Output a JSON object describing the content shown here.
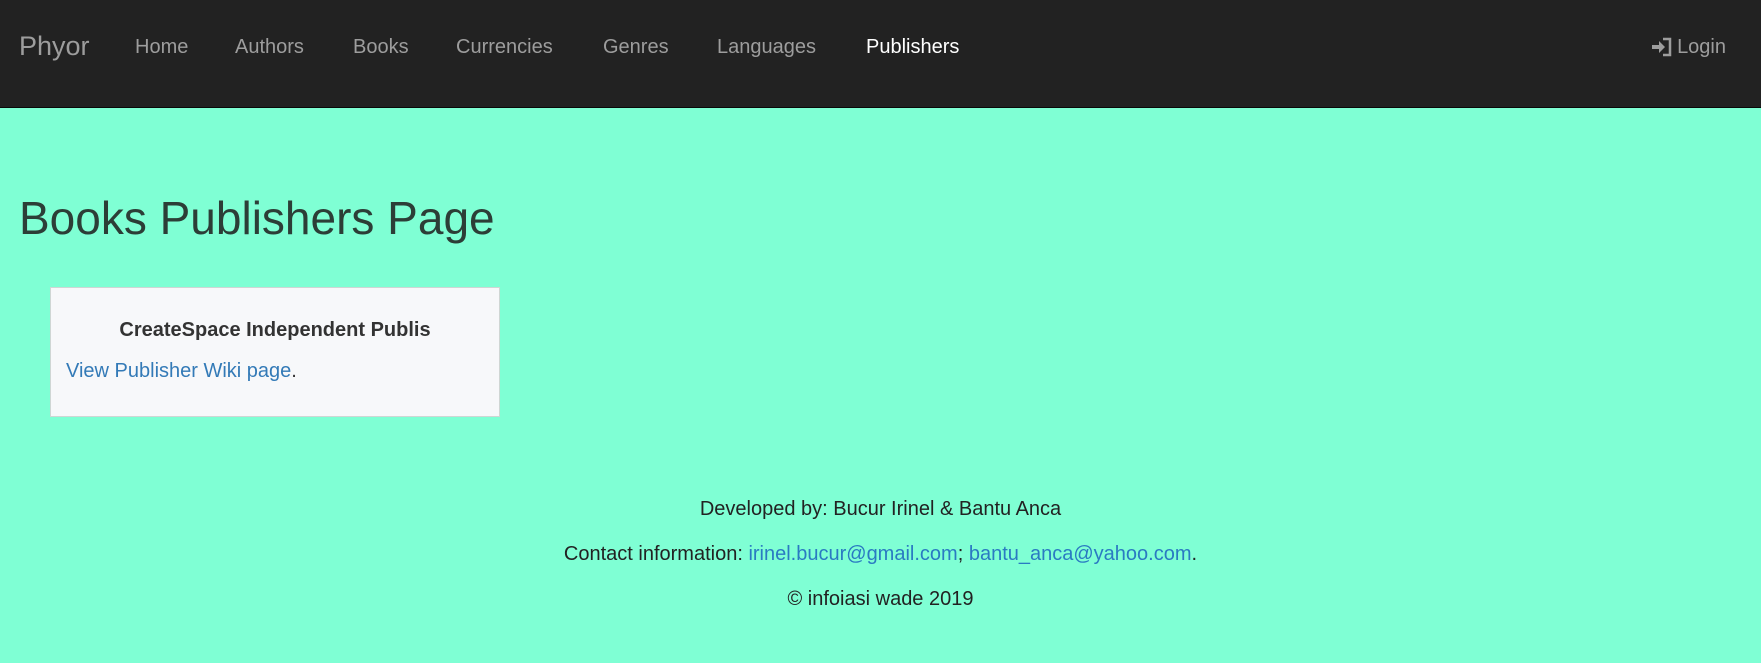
{
  "navbar": {
    "brand": "Phyor",
    "items": [
      {
        "label": "Home"
      },
      {
        "label": "Authors"
      },
      {
        "label": "Books"
      },
      {
        "label": "Currencies"
      },
      {
        "label": "Genres"
      },
      {
        "label": "Languages"
      },
      {
        "label": "Publishers",
        "active": true
      }
    ],
    "login_label": "Login",
    "login_icon": "log-in-icon"
  },
  "main": {
    "title": "Books Publishers Page",
    "cards": [
      {
        "title": "CreateSpace Independent Publis",
        "link_label": "View Publisher Wiki page",
        "link_suffix": "."
      }
    ]
  },
  "footer": {
    "developed_by": "Developed by: Bucur Irinel & Bantu Anca",
    "contact_prefix": "Contact information: ",
    "email_1": "irinel.bucur@gmail.com",
    "separator": "; ",
    "email_2": "bantu_anca@yahoo.com",
    "contact_suffix": ".",
    "copyright": "© infoiasi wade 2019"
  },
  "colors": {
    "background": "#7fffd4",
    "navbar": "#222222",
    "nav_text": "#9d9d9d",
    "nav_active": "#ffffff",
    "link": "#337ab7",
    "card_bg": "#f7f8fa"
  }
}
